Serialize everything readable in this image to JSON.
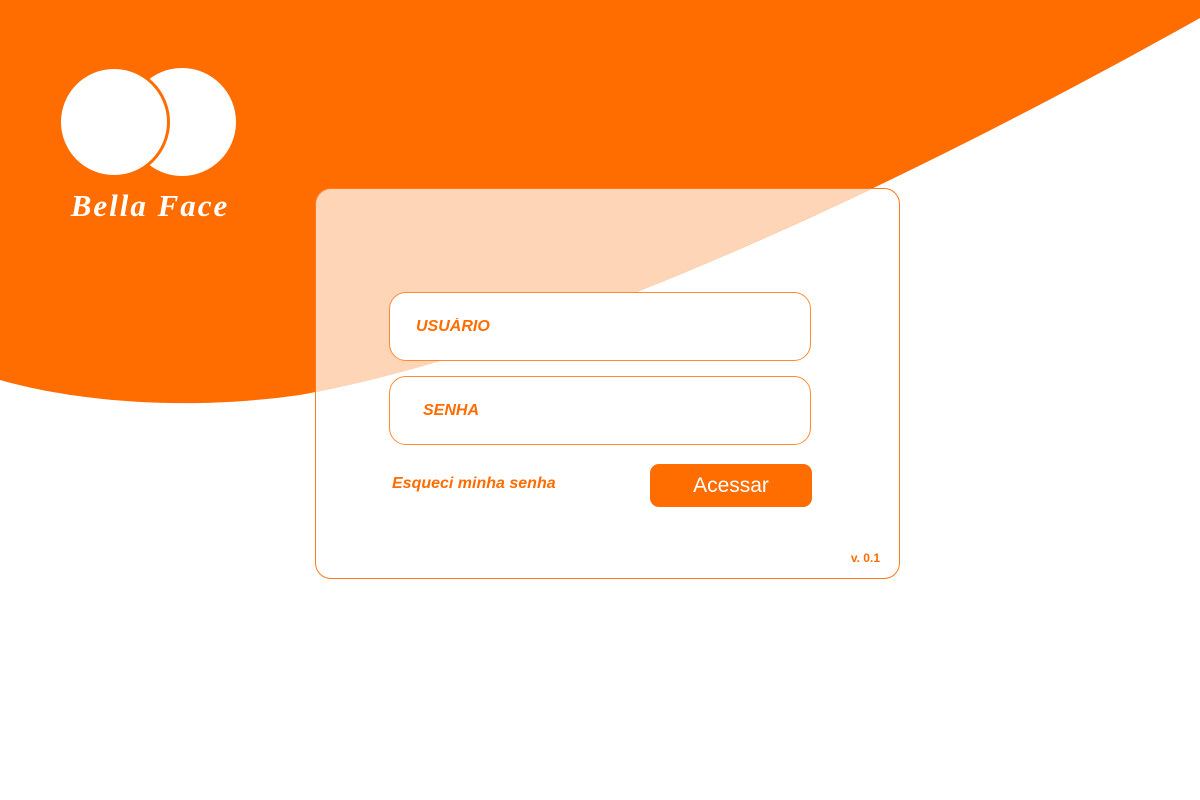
{
  "brand": {
    "name": "Bella Face"
  },
  "login": {
    "username_placeholder": "USUÁRIO",
    "password_placeholder": "SENHA",
    "forgot_password_label": "Esqueci minha senha",
    "submit_label": "Acessar",
    "version": "v. 0.1"
  },
  "colors": {
    "primary": "#ff6c00",
    "card_overlay": "#ffd5b8",
    "background": "#ffffff"
  }
}
